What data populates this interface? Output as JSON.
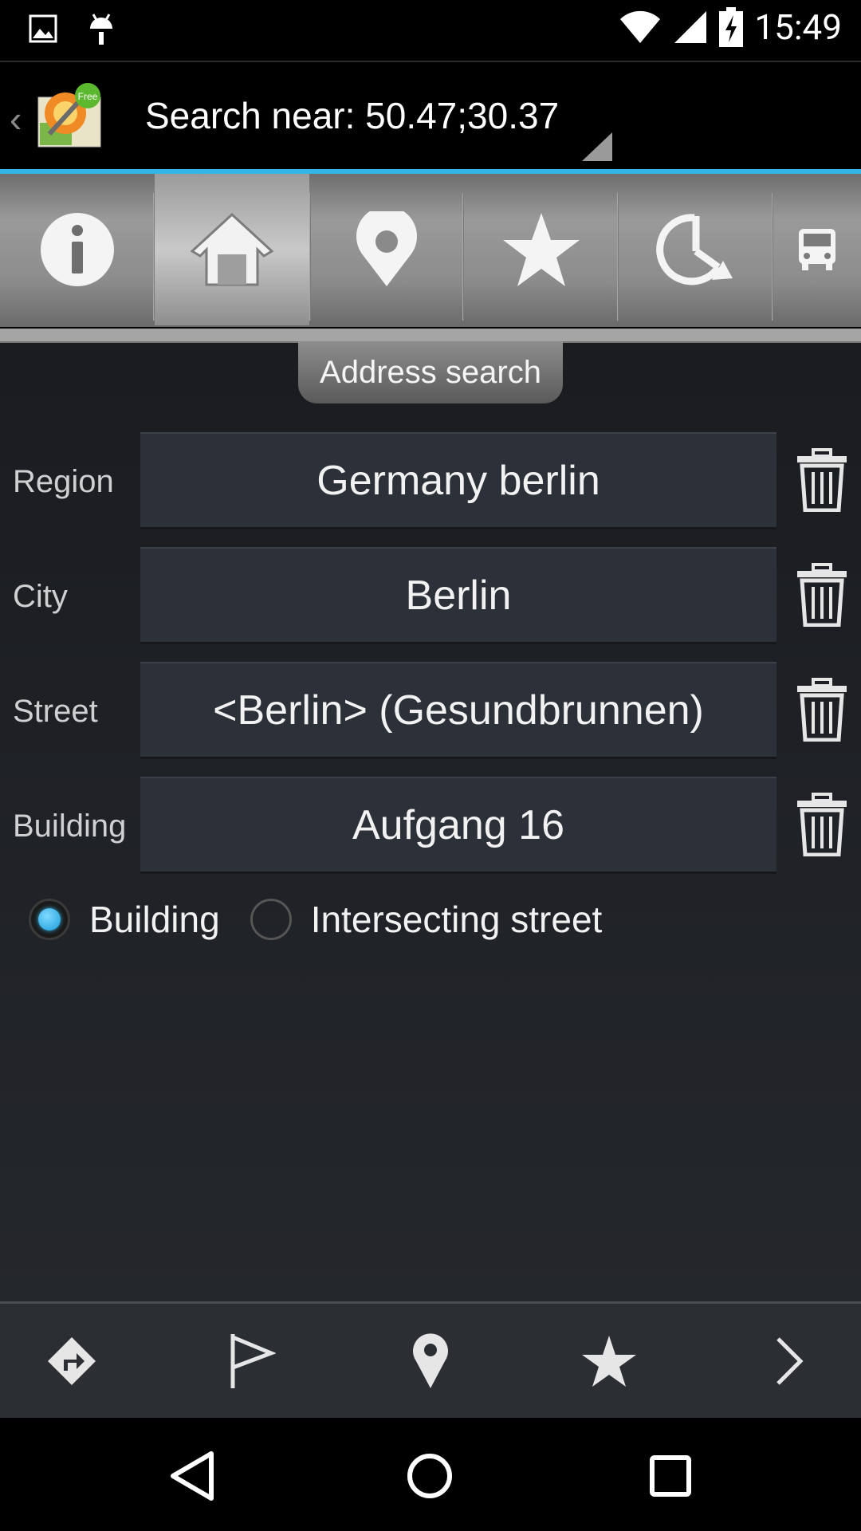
{
  "status_bar": {
    "time": "15:49",
    "icons": [
      "image-icon",
      "android-icon",
      "wifi-icon",
      "signal-icon",
      "battery-charging-icon"
    ]
  },
  "action_bar": {
    "title": "Search near: 50.47;30.37",
    "logo_badge": "Free",
    "accent_color": "#33b5e5"
  },
  "tabs": [
    {
      "name": "info",
      "icon": "info-icon",
      "active": false
    },
    {
      "name": "address",
      "icon": "home-icon",
      "active": true
    },
    {
      "name": "poi",
      "icon": "map-pin-icon",
      "active": false
    },
    {
      "name": "favorites",
      "icon": "star-icon",
      "active": false
    },
    {
      "name": "history",
      "icon": "history-icon",
      "active": false
    },
    {
      "name": "transport",
      "icon": "bus-icon",
      "active": false
    }
  ],
  "tooltip": "Address search",
  "form": {
    "rows": [
      {
        "label": "Region",
        "value": "Germany berlin"
      },
      {
        "label": "City",
        "value": "Berlin"
      },
      {
        "label": "Street",
        "value": "<Berlin> (Gesundbrunnen)"
      },
      {
        "label": "Building",
        "value": "Aufgang 16"
      }
    ],
    "radio": {
      "options": [
        "Building",
        "Intersecting street"
      ],
      "selected": "Building"
    }
  },
  "toolbar": [
    "directions-icon",
    "flag-icon",
    "map-pin-icon",
    "star-icon",
    "chevron-right-icon"
  ],
  "nav_bar": [
    "back-icon",
    "home-icon",
    "recents-icon"
  ]
}
